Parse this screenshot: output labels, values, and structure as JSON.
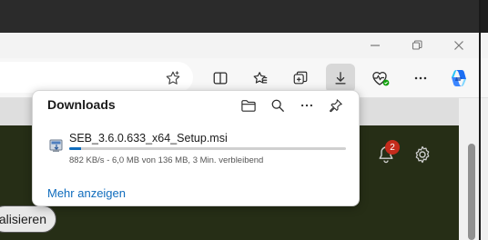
{
  "colors": {
    "accent": "#0f6cbd",
    "badge": "#c42b1c",
    "dark_banner": "#262e16",
    "titlebar": "#2b2b2b"
  },
  "window_controls": {
    "icons": [
      "minimize-icon",
      "restore-icon",
      "close-icon"
    ]
  },
  "toolbar": {
    "icons": [
      "favorite-add-icon",
      "split-screen-icon",
      "favorites-icon",
      "collections-icon",
      "downloads-icon",
      "browser-essentials-icon",
      "more-icon",
      "copilot-icon"
    ],
    "active": "downloads-icon"
  },
  "downloads": {
    "title": "Downloads",
    "actions": [
      "open-folder-icon",
      "search-icon",
      "more-options-icon",
      "pin-icon"
    ],
    "items": [
      {
        "file_name": "SEB_3.6.0.633_x64_Setup.msi",
        "status": "882 KB/s - 6,0 MB von 136 MB, 3 Min. verbleibend",
        "progress_fraction": 0.044
      }
    ],
    "more_link": "Mehr anzeigen"
  },
  "page": {
    "pill_label": "nalisieren",
    "notifications_count": "2"
  }
}
